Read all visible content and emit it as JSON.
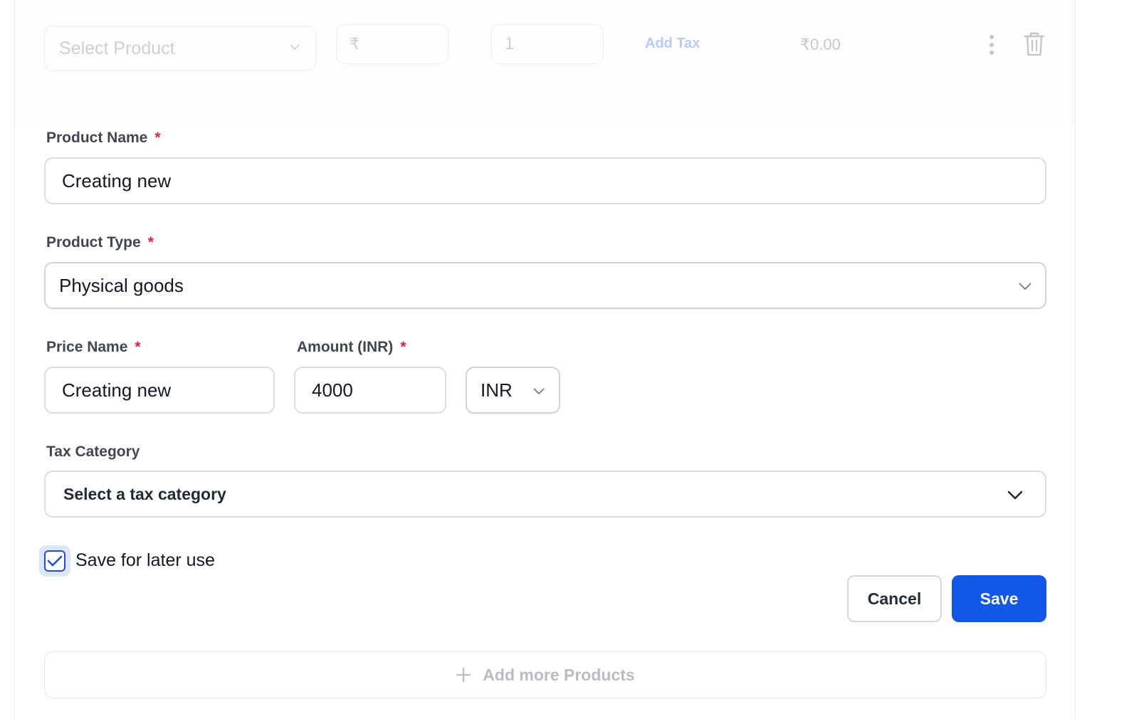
{
  "line_item": {
    "product_placeholder": "Select Product",
    "price_symbol": "₹",
    "quantity": "1",
    "add_tax_label": "Add Tax",
    "total": "₹0.00"
  },
  "form": {
    "product_name": {
      "label": "Product Name",
      "required_mark": "*",
      "value": "Creating new"
    },
    "product_type": {
      "label": "Product Type",
      "required_mark": "*",
      "value": "Physical goods"
    },
    "price_name": {
      "label": "Price Name",
      "required_mark": "*",
      "value": "Creating new"
    },
    "amount": {
      "label": "Amount (INR)",
      "required_mark": "*",
      "value": "4000"
    },
    "currency": {
      "value": "INR"
    },
    "tax_category": {
      "label": "Tax Category",
      "value": "Select a tax category"
    },
    "save_for_later": {
      "label": "Save for later use",
      "checked": true
    }
  },
  "actions": {
    "cancel_label": "Cancel",
    "save_label": "Save",
    "add_more_label": "Add more Products"
  },
  "colors": {
    "primary": "#1357e6",
    "required": "#e11d48",
    "checkbox_halo": "#dbe6fb"
  }
}
